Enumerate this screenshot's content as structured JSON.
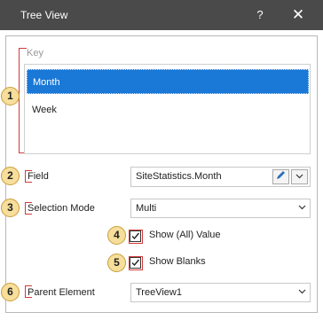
{
  "window": {
    "title": "Tree View",
    "help_label": "?",
    "close_label": "✕"
  },
  "key": {
    "label": "Key",
    "items": [
      {
        "label": "Month",
        "selected": true
      },
      {
        "label": "Week",
        "selected": false
      }
    ]
  },
  "field": {
    "label": "Field",
    "value": "SiteStatistics.Month",
    "edit_icon": "pencil-icon",
    "dropdown_icon": "chevron-down-icon"
  },
  "selection_mode": {
    "label": "Selection Mode",
    "value": "Multi"
  },
  "show_all_value": {
    "label": "Show (All) Value",
    "checked": true
  },
  "show_blanks": {
    "label": "Show Blanks",
    "checked": true
  },
  "parent_element": {
    "label": "Parent Element",
    "value": "TreeView1"
  },
  "badges": [
    "1",
    "2",
    "3",
    "4",
    "5",
    "6"
  ],
  "colors": {
    "titlebar": "#4a4a4a",
    "selection": "#1a78d6",
    "annotation_red": "#d23a3a",
    "badge_fill": "#f7de9a"
  }
}
